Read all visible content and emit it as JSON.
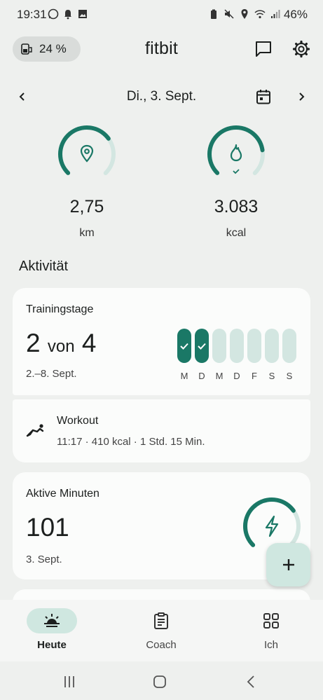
{
  "status_bar": {
    "time": "19:31",
    "battery": "46%"
  },
  "header": {
    "device_battery": "24 %",
    "title": "fitbit"
  },
  "date_nav": {
    "date": "Di., 3. Sept."
  },
  "rings": [
    {
      "value": "2,75",
      "unit": "km",
      "progress": 0.7
    },
    {
      "value": "3.083",
      "unit": "kcal",
      "progress": 0.8
    }
  ],
  "section": {
    "title": "Aktivität"
  },
  "training": {
    "title": "Trainingstage",
    "count": "2",
    "of": "von",
    "goal": "4",
    "range": "2.–8. Sept.",
    "days": [
      {
        "label": "M",
        "done": true
      },
      {
        "label": "D",
        "done": true
      },
      {
        "label": "M",
        "done": false
      },
      {
        "label": "D",
        "done": false
      },
      {
        "label": "F",
        "done": false
      },
      {
        "label": "S",
        "done": false
      },
      {
        "label": "S",
        "done": false
      }
    ]
  },
  "workout": {
    "title": "Workout",
    "details": "11:17 · 410 kcal · 1 Std. 15 Min."
  },
  "active_minutes": {
    "title": "Aktive Minuten",
    "value": "101",
    "date": "3. Sept.",
    "progress": 0.7
  },
  "bottom_nav": {
    "items": [
      {
        "label": "Heute",
        "active": true
      },
      {
        "label": "Coach",
        "active": false
      },
      {
        "label": "Ich",
        "active": false
      }
    ]
  },
  "colors": {
    "accent": "#1a7866",
    "ring_track": "#d3e6e1",
    "pill": "#cfe7e0"
  }
}
